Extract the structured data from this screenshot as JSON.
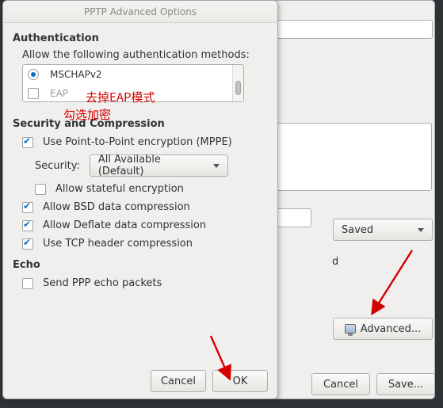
{
  "dialog": {
    "title": "PPTP Advanced Options",
    "auth": {
      "heading": "Authentication",
      "subheading": "Allow the following authentication methods:",
      "methods": [
        {
          "label": "MSCHAPv2",
          "checked": true,
          "type": "radio"
        },
        {
          "label": "EAP",
          "checked": false,
          "type": "check"
        }
      ]
    },
    "security": {
      "heading": "Security and Compression",
      "mppe": "Use Point-to-Point encryption (MPPE)",
      "security_label": "Security:",
      "security_value": "All Available (Default)",
      "stateful": "Allow stateful encryption",
      "bsd": "Allow BSD data compression",
      "deflate": "Allow Deflate data compression",
      "tcp": "Use TCP header compression"
    },
    "echo": {
      "heading": "Echo",
      "ppp": "Send PPP echo packets"
    },
    "buttons": {
      "cancel": "Cancel",
      "ok": "OK"
    }
  },
  "background": {
    "combo_value": "Saved",
    "label_d": "d",
    "advanced": "Advanced...",
    "cancel": "Cancel",
    "save": "Save..."
  },
  "annotations": {
    "line1": "去掉EAP模式",
    "line2": "勾选加密"
  }
}
